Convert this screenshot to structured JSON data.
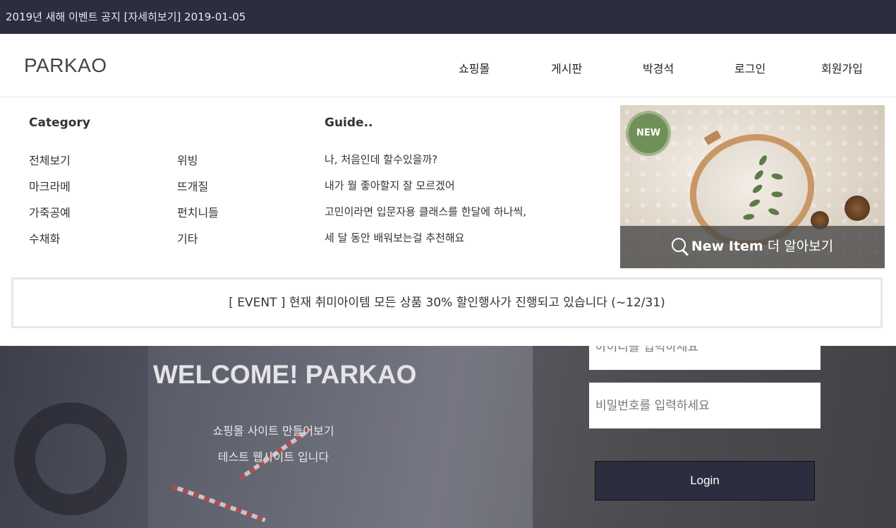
{
  "notice": {
    "text": "2019년 새해 이벤트 공지 [자세히보기] 2019-01-05"
  },
  "header": {
    "logo": "PARKAO",
    "nav": [
      "쇼핑몰",
      "게시판",
      "박경석",
      "로그인",
      "회원가입"
    ]
  },
  "mega_menu": {
    "category_title": "Category",
    "categories_col1": [
      "전체보기",
      "마크라메",
      "가죽공예",
      "수채화"
    ],
    "categories_col2": [
      "위빙",
      "뜨개질",
      "펀치니들",
      "기타"
    ],
    "guide_title": "Guide..",
    "guide_lines": [
      "나, 처음인데 할수있을까?",
      "내가 뭘 좋아할지 잘 모르겠어",
      "고민이라면 입문자용 클래스를 한달에 하나씩,",
      "세 달 동안 배워보는걸 추천해요"
    ],
    "promo": {
      "badge": "NEW",
      "caption_bold": "New Item",
      "caption_rest": " 더 알아보기"
    }
  },
  "event_banner": {
    "text": "[ EVENT ] 현재 취미아이템 모든 상품 30% 할인행사가 진행되고 있습니다 (~12/31)"
  },
  "hero": {
    "welcome": "WELCOME! PARKAO",
    "line1": "쇼핑몰 사이트 만들어보기",
    "line2": "테스트 웹사이트 입니다"
  },
  "login": {
    "id_placeholder": "아이디를 입력하세요",
    "pw_placeholder": "비밀번호를 입력하세요",
    "button": "Login"
  },
  "colors": {
    "dark_navy": "#2c2d3f",
    "badge_green": "#6f9157"
  },
  "icons": [
    "search-icon"
  ]
}
